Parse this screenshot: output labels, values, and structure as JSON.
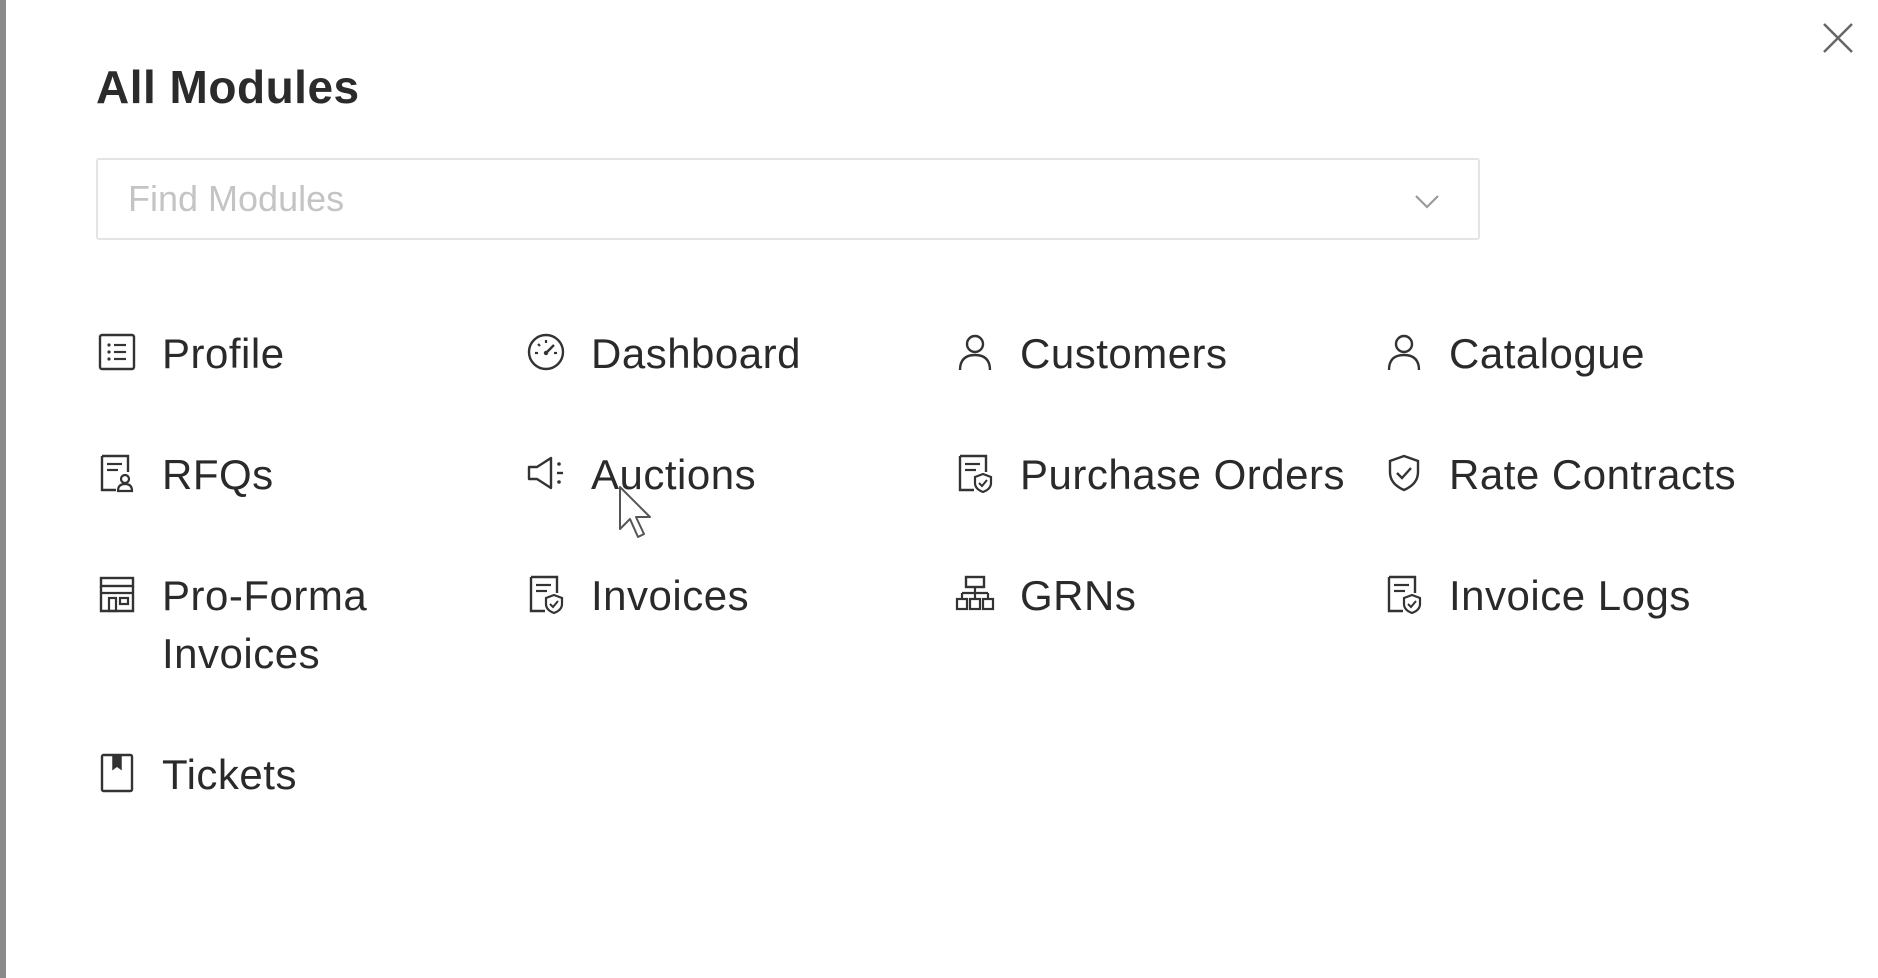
{
  "dialog": {
    "title": "All Modules",
    "close_icon": "close-icon"
  },
  "search": {
    "placeholder": "Find Modules",
    "value": "",
    "dropdown_icon": "chevron-down-icon"
  },
  "modules": [
    {
      "label": "Profile",
      "icon": "list-doc-icon"
    },
    {
      "label": "Dashboard",
      "icon": "gauge-icon"
    },
    {
      "label": "Customers",
      "icon": "user-icon"
    },
    {
      "label": "Catalogue",
      "icon": "user-icon"
    },
    {
      "label": "RFQs",
      "icon": "doc-user-icon"
    },
    {
      "label": "Auctions",
      "icon": "megaphone-icon"
    },
    {
      "label": "Purchase Orders",
      "icon": "doc-shield-icon"
    },
    {
      "label": "Rate Contracts",
      "icon": "shield-check-icon"
    },
    {
      "label": "Pro-Forma Invoices",
      "icon": "store-icon"
    },
    {
      "label": "Invoices",
      "icon": "doc-shield-icon"
    },
    {
      "label": "GRNs",
      "icon": "sitemap-icon"
    },
    {
      "label": "Invoice Logs",
      "icon": "doc-shield-icon"
    },
    {
      "label": "Tickets",
      "icon": "bookmark-icon"
    }
  ]
}
